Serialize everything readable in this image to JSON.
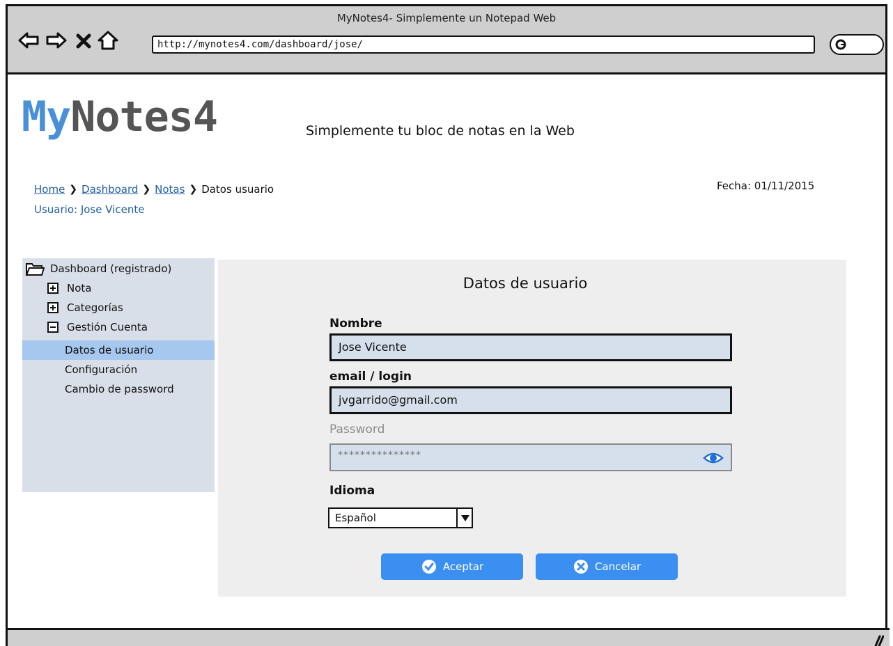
{
  "browser": {
    "title": "MyNotes4- Simplemente un Notepad Web",
    "url": "http://mynotes4.com/dashboard/jose/"
  },
  "header": {
    "logo_my": "My",
    "logo_rest": "Notes4",
    "tagline": "Simplemente tu bloc de notas en la Web"
  },
  "breadcrumb": {
    "items": [
      "Home",
      "Dashboard",
      "Notas"
    ],
    "current": "Datos usuario"
  },
  "user_line": "Usuario: Jose Vicente",
  "date_line": "Fecha: 01/11/2015",
  "sidebar": {
    "root": "Dashboard (registrado)",
    "items": [
      "Nota",
      "Categorías",
      "Gestión Cuenta"
    ],
    "subitems": [
      "Datos de usuario",
      "Configuración",
      "Cambio de password"
    ]
  },
  "form": {
    "title": "Datos de usuario",
    "nombre_label": "Nombre",
    "nombre_value": "Jose Vicente",
    "email_label": "email / login",
    "email_value": "jvgarrido@gmail.com",
    "password_label": "Password",
    "password_value": "***************",
    "idioma_label": "Idioma",
    "idioma_value": "Español",
    "accept_label": "Aceptar",
    "cancel_label": "Cancelar"
  },
  "colors": {
    "accent": "#3b8ff0",
    "logo_blue": "#4a90d9",
    "sidebar_bg": "#d9dfe8",
    "active_item": "#a6c7ee",
    "field_bg": "#d6dfec"
  },
  "icons": [
    "back-arrow-icon",
    "forward-arrow-icon",
    "stop-icon",
    "home-icon",
    "search-icon",
    "folder-icon",
    "plus-box-icon",
    "minus-box-icon",
    "eye-icon",
    "check-circle-icon",
    "cancel-circle-icon",
    "resize-grip-icon"
  ]
}
